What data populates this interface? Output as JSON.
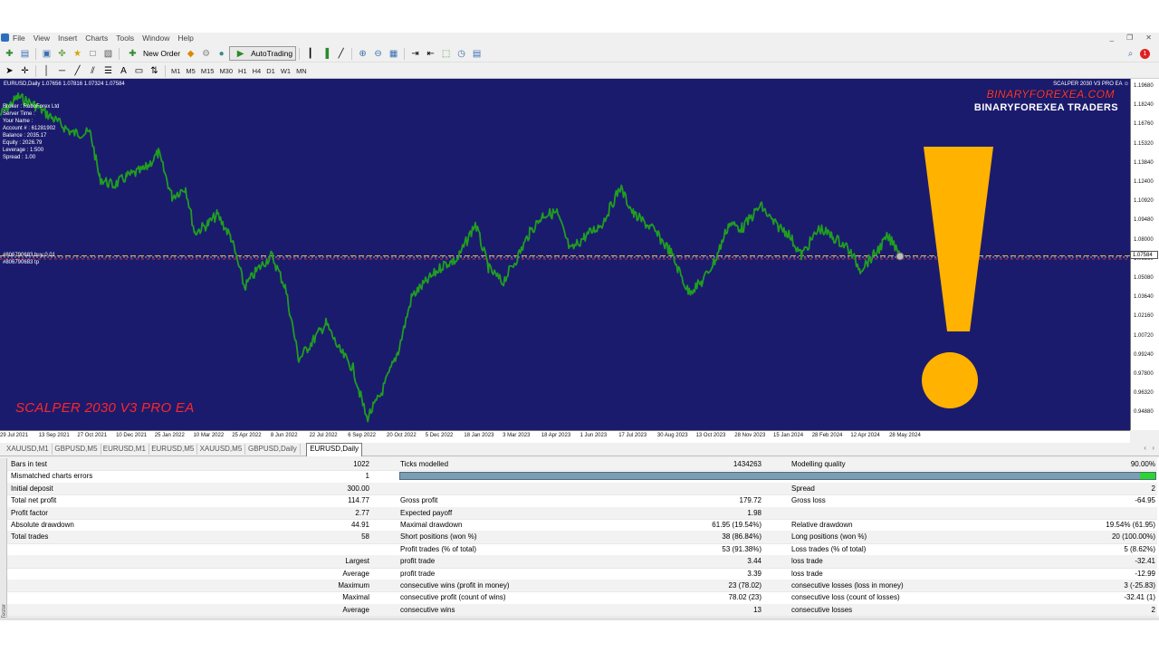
{
  "menu": {
    "items": [
      "File",
      "View",
      "Insert",
      "Charts",
      "Tools",
      "Window",
      "Help"
    ]
  },
  "toolbar": {
    "new_order": "New Order",
    "auto_trading": "AutoTrading",
    "timeframes": [
      "M1",
      "M5",
      "M15",
      "M30",
      "H1",
      "H4",
      "D1",
      "W1",
      "MN"
    ]
  },
  "chart": {
    "symbol_line": "EURUSD,Daily  1.07656 1.07816 1.07324 1.07584",
    "ea_title": "SCALPER 2030 V3 PRO EA ☺",
    "info": [
      "Broker  : RoboForex Ltd",
      "Server Time :",
      "Your Name  :",
      "Account #  : 61281902",
      "Balance : 2035.17",
      "Equity  : 2026.79",
      "Leverage : 1:500",
      "Spread : 1.00"
    ],
    "order_tag": "#806790683 tp",
    "order_tag2": "#806790683 buy 0.01",
    "brand_red": "BINARYFOREXEA.COM",
    "brand_white": "BINARYFOREXEA TRADERS",
    "overlay_text": "SCALPER 2030 V3 PRO EA",
    "price_levels": [
      "1.19680",
      "1.18240",
      "1.16760",
      "1.15320",
      "1.13840",
      "1.12400",
      "1.10920",
      "1.09480",
      "1.08000",
      "1.06560",
      "1.05080",
      "1.03640",
      "1.02160",
      "1.00720",
      "0.99240",
      "0.97800",
      "0.96320",
      "0.94880"
    ],
    "current_price": "1.07584",
    "dates": [
      "29 Jul 2021",
      "13 Sep 2021",
      "27 Oct 2021",
      "10 Dec 2021",
      "25 Jan 2022",
      "10 Mar 2022",
      "25 Apr 2022",
      "8 Jun 2022",
      "22 Jul 2022",
      "6 Sep 2022",
      "20 Oct 2022",
      "5 Dec 2022",
      "18 Jan 2023",
      "3 Mar 2023",
      "18 Apr 2023",
      "1 Jun 2023",
      "17 Jul 2023",
      "30 Aug 2023",
      "13 Oct 2023",
      "28 Nov 2023",
      "15 Jan 2024",
      "28 Feb 2024",
      "12 Apr 2024",
      "28 May 2024"
    ],
    "colors": {
      "background": "#1b1b6e",
      "price_line": "#1f9e1f",
      "exclamation": "#ffb200",
      "brand_red": "#ff3b3b"
    }
  },
  "tabs": [
    {
      "label": "XAUUSD,M1",
      "active": false
    },
    {
      "label": "GBPUSD,M5",
      "active": false
    },
    {
      "label": "EURUSD,M1",
      "active": false
    },
    {
      "label": "EURUSD,M5",
      "active": false
    },
    {
      "label": "XAUUSD,M5",
      "active": false
    },
    {
      "label": "GBPUSD,Daily",
      "active": false
    },
    {
      "label": "EURUSD,Daily",
      "active": true
    }
  ],
  "report": {
    "bars_in_test": {
      "label": "Bars in test",
      "value": "1022"
    },
    "ticks_modelled": {
      "label": "Ticks modelled",
      "value": "1434263"
    },
    "modelling_quality": {
      "label": "Modelling quality",
      "value": "90.00%",
      "fraction": 0.9
    },
    "mismatched": {
      "label": "Mismatched charts errors",
      "value": "1"
    },
    "initial_deposit": {
      "label": "Initial deposit",
      "value": "300.00"
    },
    "spread": {
      "label": "Spread",
      "value": "2"
    },
    "total_net_profit": {
      "label": "Total net profit",
      "value": "114.77"
    },
    "gross_profit": {
      "label": "Gross profit",
      "value": "179.72"
    },
    "gross_loss": {
      "label": "Gross loss",
      "value": "-64.95"
    },
    "profit_factor": {
      "label": "Profit factor",
      "value": "2.77"
    },
    "expected_payoff": {
      "label": "Expected payoff",
      "value": "1.98"
    },
    "absolute_drawdown": {
      "label": "Absolute drawdown",
      "value": "44.91"
    },
    "maximal_drawdown": {
      "label": "Maximal drawdown",
      "value": "61.95 (19.54%)"
    },
    "relative_drawdown": {
      "label": "Relative drawdown",
      "value": "19.54% (61.95)"
    },
    "total_trades": {
      "label": "Total trades",
      "value": "58"
    },
    "short_positions": {
      "label": "Short positions (won %)",
      "value": "38 (86.84%)"
    },
    "long_positions": {
      "label": "Long positions (won %)",
      "value": "20 (100.00%)"
    },
    "profit_trades": {
      "label": "Profit trades (% of total)",
      "value": "53 (91.38%)"
    },
    "loss_trades": {
      "label": "Loss trades (% of total)",
      "value": "5 (8.62%)"
    },
    "largest": {
      "label": "Largest",
      "profit_label": "profit trade",
      "profit_value": "3.44",
      "loss_label": "loss trade",
      "loss_value": "-32.41"
    },
    "average": {
      "label": "Average",
      "profit_label": "profit trade",
      "profit_value": "3.39",
      "loss_label": "loss trade",
      "loss_value": "-12.99"
    },
    "maximum": {
      "label": "Maximum",
      "profit_label": "consecutive wins (profit in money)",
      "profit_value": "23 (78.02)",
      "loss_label": "consecutive losses (loss in money)",
      "loss_value": "3 (-25.83)"
    },
    "maximal": {
      "label": "Maximal",
      "profit_label": "consecutive profit (count of wins)",
      "profit_value": "78.02 (23)",
      "loss_label": "consecutive loss (count of losses)",
      "loss_value": "-32.41 (1)"
    },
    "average2": {
      "label": "Average",
      "profit_label": "consecutive wins",
      "profit_value": "13",
      "loss_label": "consecutive losses",
      "loss_value": "2"
    }
  }
}
